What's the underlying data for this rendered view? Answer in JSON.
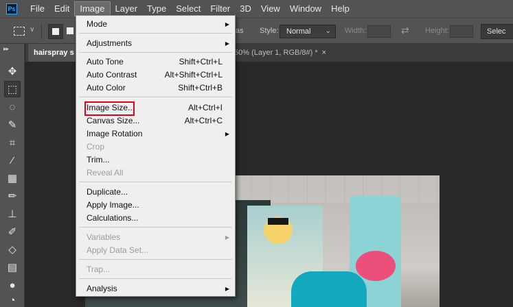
{
  "menubar": {
    "logo": "Ps",
    "items": [
      "File",
      "Edit",
      "Image",
      "Layer",
      "Type",
      "Select",
      "Filter",
      "3D",
      "View",
      "Window",
      "Help"
    ],
    "active": "Image"
  },
  "options": {
    "chevron": "∨",
    "antialias_fragment": "as",
    "style_label": "Style:",
    "style_value": "Normal",
    "width_label": "Width:",
    "height_label": "Height:",
    "select_button": "Selec",
    "swap_glyph": "⇄"
  },
  "tabs": {
    "active": "hairspray s",
    "other": "50% (Layer 1, RGB/8#) *",
    "close_glyph": "×"
  },
  "tools": [
    {
      "name": "move-tool-icon",
      "glyph": "✥"
    },
    {
      "name": "marquee-tool-icon",
      "glyph": "⬚"
    },
    {
      "name": "lasso-tool-icon",
      "glyph": "◌"
    },
    {
      "name": "quick-selection-tool-icon",
      "glyph": "✎"
    },
    {
      "name": "crop-tool-icon",
      "glyph": "⌗"
    },
    {
      "name": "eyedropper-tool-icon",
      "glyph": "⁄"
    },
    {
      "name": "healing-brush-tool-icon",
      "glyph": "▦"
    },
    {
      "name": "brush-tool-icon",
      "glyph": "✏"
    },
    {
      "name": "clone-stamp-tool-icon",
      "glyph": "⊥"
    },
    {
      "name": "history-brush-tool-icon",
      "glyph": "✐"
    },
    {
      "name": "eraser-tool-icon",
      "glyph": "◇"
    },
    {
      "name": "gradient-tool-icon",
      "glyph": "▤"
    },
    {
      "name": "blur-tool-icon",
      "glyph": "●"
    },
    {
      "name": "dodge-tool-icon",
      "glyph": "◔"
    }
  ],
  "image_menu": {
    "mode": "Mode",
    "adjustments": "Adjustments",
    "auto_tone": "Auto Tone",
    "auto_tone_sc": "Shift+Ctrl+L",
    "auto_contrast": "Auto Contrast",
    "auto_contrast_sc": "Alt+Shift+Ctrl+L",
    "auto_color": "Auto Color",
    "auto_color_sc": "Shift+Ctrl+B",
    "image_size": "Image Size...",
    "image_size_sc": "Alt+Ctrl+I",
    "canvas_size": "Canvas Size...",
    "canvas_size_sc": "Alt+Ctrl+C",
    "image_rotation": "Image Rotation",
    "crop": "Crop",
    "trim": "Trim...",
    "reveal_all": "Reveal All",
    "duplicate": "Duplicate...",
    "apply_image": "Apply Image...",
    "calculations": "Calculations...",
    "variables": "Variables",
    "apply_data_set": "Apply Data Set...",
    "trap": "Trap...",
    "analysis": "Analysis",
    "submenu_arrow": "▶"
  },
  "colors": {
    "highlight": "#e0001b",
    "menu_bg": "#efefef",
    "chrome": "#535353"
  }
}
